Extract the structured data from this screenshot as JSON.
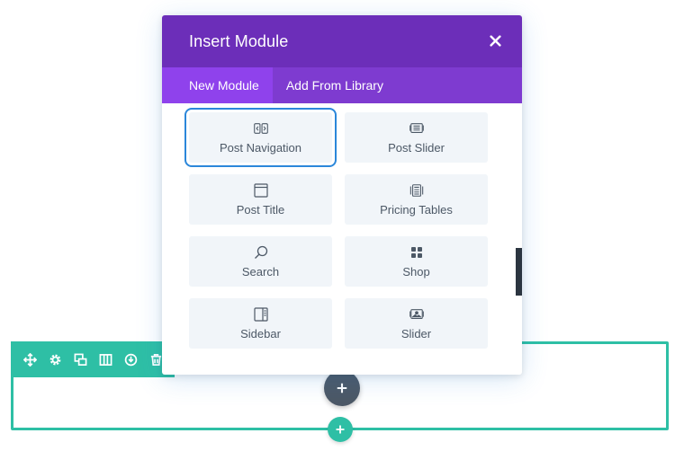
{
  "modal": {
    "title": "Insert Module",
    "tabs": [
      {
        "label": "New Module",
        "active": true
      },
      {
        "label": "Add From Library",
        "active": false
      }
    ]
  },
  "modules": [
    {
      "label": "Post Navigation",
      "icon": "post-navigation-icon",
      "selected": true
    },
    {
      "label": "Post Slider",
      "icon": "post-slider-icon"
    },
    {
      "label": "Post Title",
      "icon": "post-title-icon"
    },
    {
      "label": "Pricing Tables",
      "icon": "pricing-tables-icon"
    },
    {
      "label": "Search",
      "icon": "search-icon"
    },
    {
      "label": "Shop",
      "icon": "shop-icon"
    },
    {
      "label": "Sidebar",
      "icon": "sidebar-icon"
    },
    {
      "label": "Slider",
      "icon": "slider-icon"
    }
  ],
  "section_toolbar": {
    "icons": [
      "move-icon",
      "gear-icon",
      "duplicate-icon",
      "columns-icon",
      "save-icon",
      "delete-icon"
    ]
  },
  "colors": {
    "header": "#6c2eb9",
    "tabs": "#7e3bd0",
    "active_tab": "#8f42ec",
    "section": "#2ebfa5",
    "module_bg": "#f1f5f9",
    "selected_outline": "#2b87da",
    "add_module_button": "#4c5866"
  }
}
